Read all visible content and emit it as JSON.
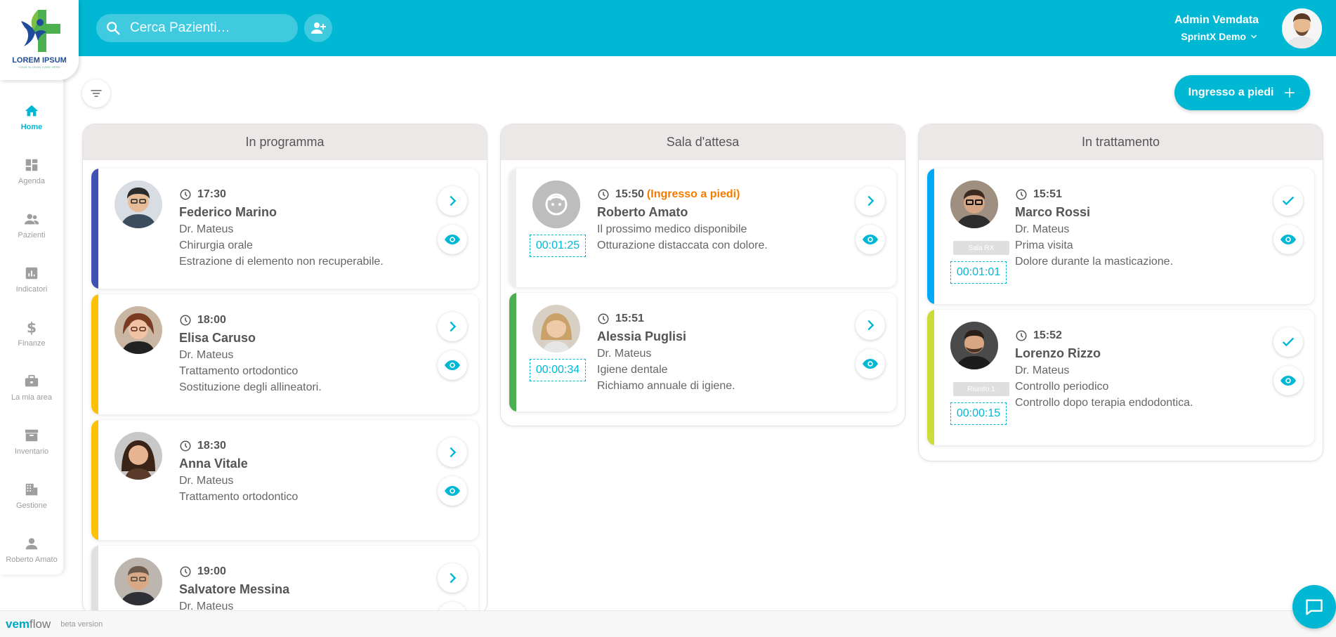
{
  "header": {
    "search_placeholder": "Cerca Pazienti…",
    "user_name": "Admin Vemdata",
    "org_name": "SprintX Demo"
  },
  "logo": {
    "title": "LOREM IPSUM",
    "subtitle": "YOUR SLOGAN CARE HERE"
  },
  "sidebar": {
    "items": [
      {
        "label": "Home",
        "icon": "home-icon",
        "active": true
      },
      {
        "label": "Agenda",
        "icon": "dashboard-icon"
      },
      {
        "label": "Pazienti",
        "icon": "people-icon"
      },
      {
        "label": "Indicatori",
        "icon": "bar-chart-icon"
      },
      {
        "label": "Finanze",
        "icon": "dollar-icon"
      },
      {
        "label": "La mia area",
        "icon": "briefcase-icon"
      },
      {
        "label": "Inventario",
        "icon": "archive-icon"
      },
      {
        "label": "Gestione",
        "icon": "building-icon"
      },
      {
        "label": "Roberto Amato",
        "icon": "person-icon"
      }
    ]
  },
  "toolbar": {
    "walkin_label": "Ingresso a piedi"
  },
  "columns": [
    {
      "title": "In programma",
      "cards": [
        {
          "time": "17:30",
          "name": "Federico Marino",
          "doctor": "Dr. Mateus",
          "treatment": "Chirurgia orale",
          "note": "Estrazione di elemento non recuperabile.",
          "color": "#3f51b5"
        },
        {
          "time": "18:00",
          "name": "Elisa Caruso",
          "doctor": "Dr. Mateus",
          "treatment": "Trattamento ortodontico",
          "note": "Sostituzione degli allineatori.",
          "color": "#ffc107"
        },
        {
          "time": "18:30",
          "name": "Anna Vitale",
          "doctor": "Dr. Mateus",
          "treatment": "Trattamento ortodontico",
          "note": "",
          "color": "#ffc107"
        },
        {
          "time": "19:00",
          "name": "Salvatore Messina",
          "doctor": "Dr. Mateus",
          "treatment": "",
          "note": "",
          "color": "#e0e0e0"
        }
      ]
    },
    {
      "title": "Sala d'attesa",
      "cards": [
        {
          "time": "15:50",
          "walk_in": "(Ingresso a piedi)",
          "name": "Roberto Amato",
          "doctor": "Il prossimo medico disponibile",
          "treatment": "Otturazione distaccata con dolore.",
          "timer": "00:01:25",
          "color": "#eeeeee"
        },
        {
          "time": "15:51",
          "name": "Alessia Puglisi",
          "doctor": "Dr. Mateus",
          "treatment": "Igiene dentale",
          "note": "Richiamo annuale di igiene.",
          "timer": "00:00:34",
          "color": "#4caf50"
        }
      ]
    },
    {
      "title": "In trattamento",
      "cards": [
        {
          "time": "15:51",
          "name": "Marco Rossi",
          "doctor": "Dr. Mateus",
          "treatment": "Prima visita",
          "note": "Dolore durante la masticazione.",
          "room": "Sala RX",
          "timer": "00:01:01",
          "color": "#03a9f4"
        },
        {
          "time": "15:52",
          "name": "Lorenzo Rizzo",
          "doctor": "Dr. Mateus",
          "treatment": "Controllo periodico",
          "note": "Controllo dopo terapia endodontica.",
          "room": "Riunito 1",
          "timer": "00:00:15",
          "color": "#cddc39"
        }
      ]
    }
  ],
  "footer": {
    "brand_a": "vem",
    "brand_b": "flow",
    "beta": "beta version"
  }
}
